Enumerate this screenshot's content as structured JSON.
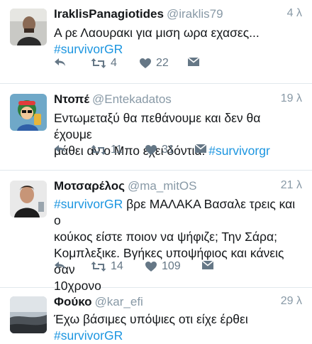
{
  "colors": {
    "link": "#1b95e0",
    "meta": "#8899a6",
    "icon": "#657786",
    "divider": "#e1e8ed"
  },
  "tweets": [
    {
      "name": "IraklisPanagiotides",
      "handle": "@iraklis79",
      "time": "4 λ",
      "text_line1": "Α ρε Λαουρακι για μιση ωρα εχασες...",
      "hashtag": "#survivorGR",
      "retweets": "4",
      "likes": "22"
    },
    {
      "name": "Ντοπέ",
      "handle": "@Entekadatos",
      "time": "19 λ",
      "text_line1": "Εντωμεταξύ θα πεθάνουμε και δεν θα έχουμε",
      "text_line2": "μάθει αν ο Μπο εχει δόντια. ",
      "hashtag": "#survivorgr",
      "retweets": "11",
      "likes": "31"
    },
    {
      "name": "Μοτσαρέλος",
      "handle": "@ma_mitOS",
      "time": "21 λ",
      "hashtag": "#survivorGR",
      "text_line1_rest": " βρε ΜΑΛΑΚΑ Βασαλε τρεις και ο",
      "text_line2": "κούκος είστε ποιον να ψήφιζε; Την Σάρα;",
      "text_line3": "Κομπλεξικε. Βγήκες υποψήφιος και κάνεις σαν",
      "text_line4": "10χρονο",
      "retweets": "14",
      "likes": "109"
    },
    {
      "name": "Φούκο",
      "handle": "@kar_efi",
      "time": "29 λ",
      "text_line1": "Έχω βάσιμες υπόψιες οτι είχε έρθει",
      "hashtag": "#survivorGR"
    }
  ]
}
